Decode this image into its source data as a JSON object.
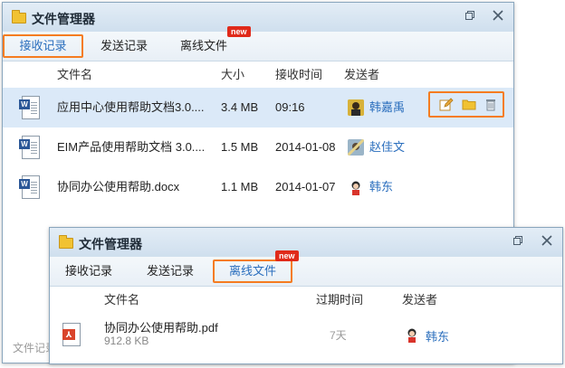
{
  "window1": {
    "title": "文件管理器",
    "tabs": [
      {
        "label": "接收记录"
      },
      {
        "label": "发送记录"
      },
      {
        "label": "离线文件"
      }
    ],
    "new_badge": "new",
    "columns": {
      "name": "文件名",
      "size": "大小",
      "time": "接收时间",
      "sender": "发送者"
    },
    "files": [
      {
        "name": "应用中心使用帮助文档3.0....",
        "size": "3.4 MB",
        "time": "09:16",
        "sender": "韩嘉禹"
      },
      {
        "name": "EIM产品使用帮助文档 3.0....",
        "size": "1.5 MB",
        "time": "2014-01-08",
        "sender": "赵佳文"
      },
      {
        "name": "协同办公使用帮助.docx",
        "size": "1.1 MB",
        "time": "2014-01-07",
        "sender": "韩东"
      }
    ],
    "bottom_text": "文件记录"
  },
  "window2": {
    "title": "文件管理器",
    "tabs": [
      {
        "label": "接收记录"
      },
      {
        "label": "发送记录"
      },
      {
        "label": "离线文件"
      }
    ],
    "new_badge": "new",
    "columns": {
      "name": "文件名",
      "expire": "过期时间",
      "sender": "发送者"
    },
    "files": [
      {
        "name": "协同办公使用帮助.pdf",
        "size": "912.8 KB",
        "expire": "7天",
        "sender": "韩东"
      }
    ]
  },
  "colors": {
    "accent": "#2a6ebd",
    "highlight_border": "#f57c20",
    "badge": "#e02a1a",
    "selected_row": "#dbe9f8"
  }
}
